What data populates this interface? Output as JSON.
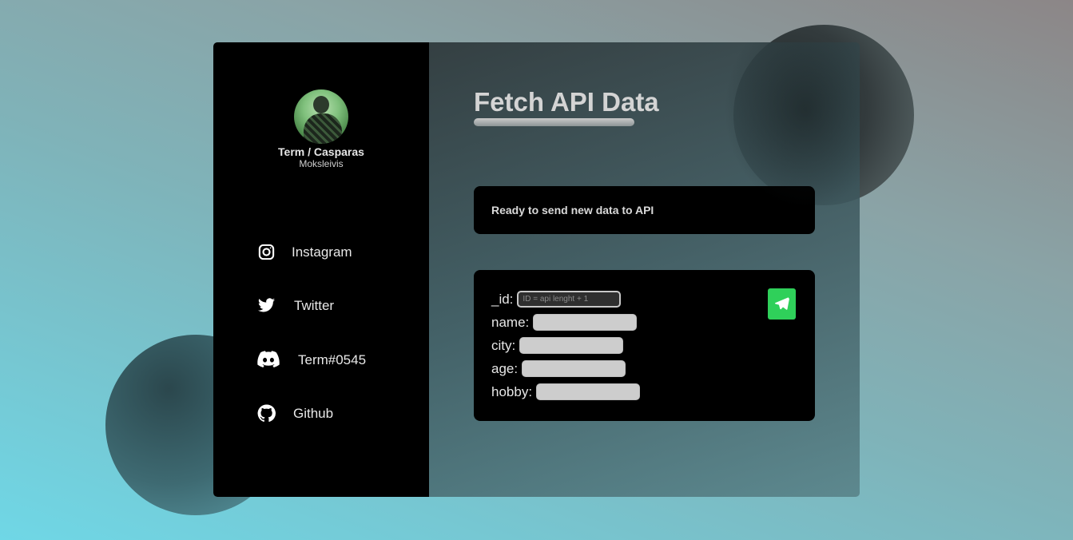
{
  "profile": {
    "name": "Term / Casparas",
    "subname": "Moksleivis"
  },
  "socials": [
    {
      "label": "Instagram",
      "icon": "instagram-icon"
    },
    {
      "label": "Twitter",
      "icon": "twitter-icon"
    },
    {
      "label": "Term#0545",
      "icon": "discord-icon"
    },
    {
      "label": "Github",
      "icon": "github-icon"
    }
  ],
  "main": {
    "title": "Fetch API Data",
    "status": "Ready to send new data to API"
  },
  "form": {
    "fields": [
      {
        "label": "_id:",
        "placeholder": "ID = api lenght + 1",
        "value": ""
      },
      {
        "label": "name:",
        "placeholder": "",
        "value": ""
      },
      {
        "label": "city:",
        "placeholder": "",
        "value": ""
      },
      {
        "label": "age:",
        "placeholder": "",
        "value": ""
      },
      {
        "label": "hobby:",
        "placeholder": "",
        "value": ""
      }
    ],
    "send_icon": "paper-plane-icon"
  },
  "colors": {
    "accent": "#2fd05a",
    "panel": "#000000",
    "title": "#d4d4d4"
  }
}
